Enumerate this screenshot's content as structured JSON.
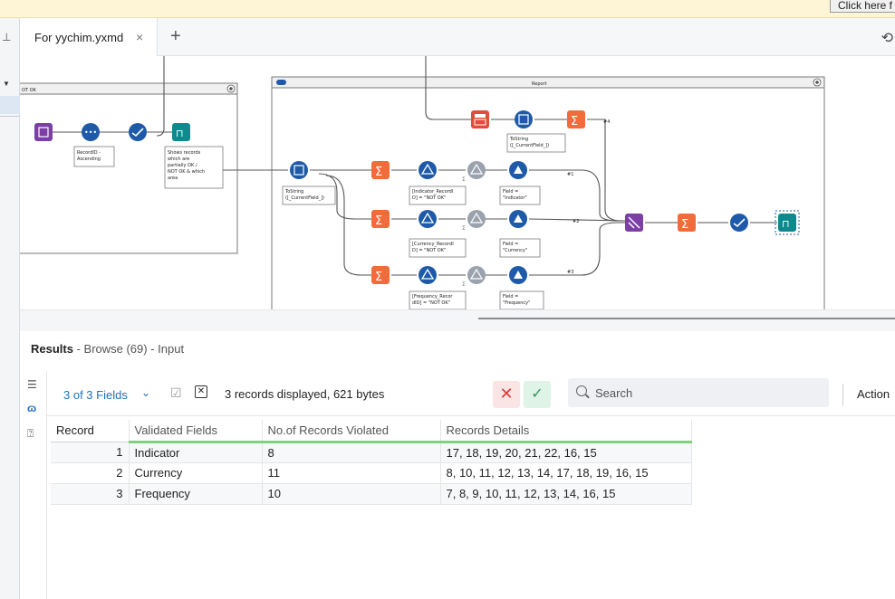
{
  "banner": {
    "button_label": "Click here f"
  },
  "tabs": [
    {
      "label": "For yychim.yxmd",
      "close": "×"
    }
  ],
  "tab_add": "+",
  "canvas": {
    "left_container_title": "OT OK",
    "report_container_title": "Report",
    "annotations": {
      "recordid": [
        "RecordID -",
        "Ascending"
      ],
      "browse_note": [
        "Shows records",
        "which are",
        "partially OK /",
        "NOT OK & which",
        "area"
      ],
      "tostring_main": [
        "ToString",
        "([_CurrentField_])"
      ],
      "tostring_top": [
        "ToString",
        "([_CurrentField_])"
      ],
      "indicator_filter": [
        "[Indicator_RecordI",
        "D] = \"NOT OK\""
      ],
      "currency_filter": [
        "[Currency_RecordI",
        "D] = \"NOT OK\""
      ],
      "frequency_filter": [
        "[Frequency_Recor",
        "dID] = \"NOT OK\""
      ],
      "field_indicator": [
        "Field =",
        "\"Indicator\""
      ],
      "field_currency": [
        "Field =",
        "\"Currency\""
      ],
      "field_frequency": [
        "Field =",
        "\"Frequency\""
      ]
    },
    "connection_labels": {
      "top": "#4",
      "one": "#1",
      "two": "#2",
      "three": "#3"
    }
  },
  "results": {
    "title": "Results",
    "subtitle": " - Browse (69) - Input",
    "fields_selector": "3 of 3 Fields",
    "record_info": "3 records displayed, 621 bytes",
    "search_placeholder": "Search",
    "actions_label": "Action",
    "columns": [
      "Record",
      "Validated Fields",
      "No.of Records Violated",
      "Records Details"
    ],
    "rows": [
      {
        "record": "1",
        "field": "Indicator",
        "violated": "8",
        "details": "17, 18, 19, 20, 21, 22, 16, 15"
      },
      {
        "record": "2",
        "field": "Currency",
        "violated": "11",
        "details": "8, 10, 11, 12, 13, 14, 17, 18, 19, 16, 15"
      },
      {
        "record": "3",
        "field": "Frequency",
        "violated": "10",
        "details": "7, 8, 9, 10, 11, 12, 13, 14, 16, 15"
      }
    ]
  },
  "colors": {
    "accent": "#1f6fbf",
    "tool_blue": "#1e5aa8",
    "tool_orange": "#f26b3a",
    "tool_purple": "#7b3fa6",
    "tool_teal": "#0e8a8f",
    "tool_red": "#e34b3b",
    "connector_green": "#9ad24a",
    "header_underline": "#7fd07f"
  }
}
